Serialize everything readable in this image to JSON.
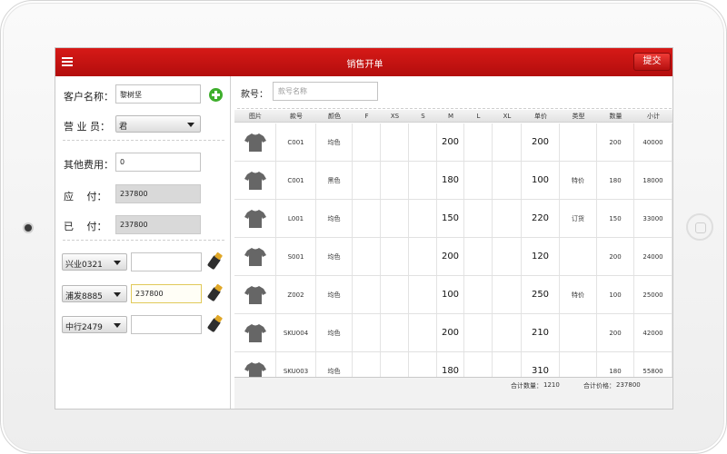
{
  "header": {
    "title": "销售开单",
    "submit_label": "提交"
  },
  "form": {
    "customer_label": "客户名称：",
    "customer_value": "黎树坚",
    "salesperson_label": "营 业 员：",
    "salesperson_value": "君",
    "other_fee_label": "其他费用：",
    "other_fee_value": "0",
    "payable_label": "应　 付：",
    "payable_value": "237800",
    "paid_label": "已　 付：",
    "paid_value": "237800",
    "payments": [
      {
        "bank": "兴业0321",
        "amount": ""
      },
      {
        "bank": "浦发8885",
        "amount": "237800"
      },
      {
        "bank": "中行2479",
        "amount": ""
      }
    ]
  },
  "search": {
    "label": "款号：",
    "placeholder": "款号名称"
  },
  "table": {
    "headers": [
      "图片",
      "款号",
      "颜色",
      "F",
      "XS",
      "S",
      "M",
      "L",
      "XL",
      "单价",
      "类型",
      "数量",
      "小计"
    ],
    "rows": [
      {
        "code": "C001",
        "color": "均色",
        "m": "200",
        "price": "200",
        "type": "",
        "qty": "200",
        "subtotal": "40000"
      },
      {
        "code": "C001",
        "color": "黑色",
        "m": "180",
        "price": "100",
        "type": "特价",
        "qty": "180",
        "subtotal": "18000"
      },
      {
        "code": "L001",
        "color": "均色",
        "m": "150",
        "price": "220",
        "type": "订货",
        "qty": "150",
        "subtotal": "33000"
      },
      {
        "code": "S001",
        "color": "均色",
        "m": "200",
        "price": "120",
        "type": "",
        "qty": "200",
        "subtotal": "24000"
      },
      {
        "code": "Z002",
        "color": "均色",
        "m": "100",
        "price": "250",
        "type": "特价",
        "qty": "100",
        "subtotal": "25000"
      },
      {
        "code": "SKU004",
        "color": "均色",
        "m": "200",
        "price": "210",
        "type": "",
        "qty": "200",
        "subtotal": "42000"
      },
      {
        "code": "SKU003",
        "color": "均色",
        "m": "180",
        "price": "310",
        "type": "",
        "qty": "180",
        "subtotal": "55800"
      }
    ]
  },
  "footer": {
    "total_qty_label": "合计数量：",
    "total_qty": "1210",
    "total_price_label": "合计价格：",
    "total_price": "237800"
  },
  "icons": {
    "menu": "menu-icon",
    "add": "add-customer-icon",
    "card": "card-swipe-icon",
    "shirt": "tshirt-icon"
  },
  "colors": {
    "header": "#c8120f",
    "add": "#3eae2c",
    "shirt": "#666666",
    "card_chip": "#e0a727"
  }
}
